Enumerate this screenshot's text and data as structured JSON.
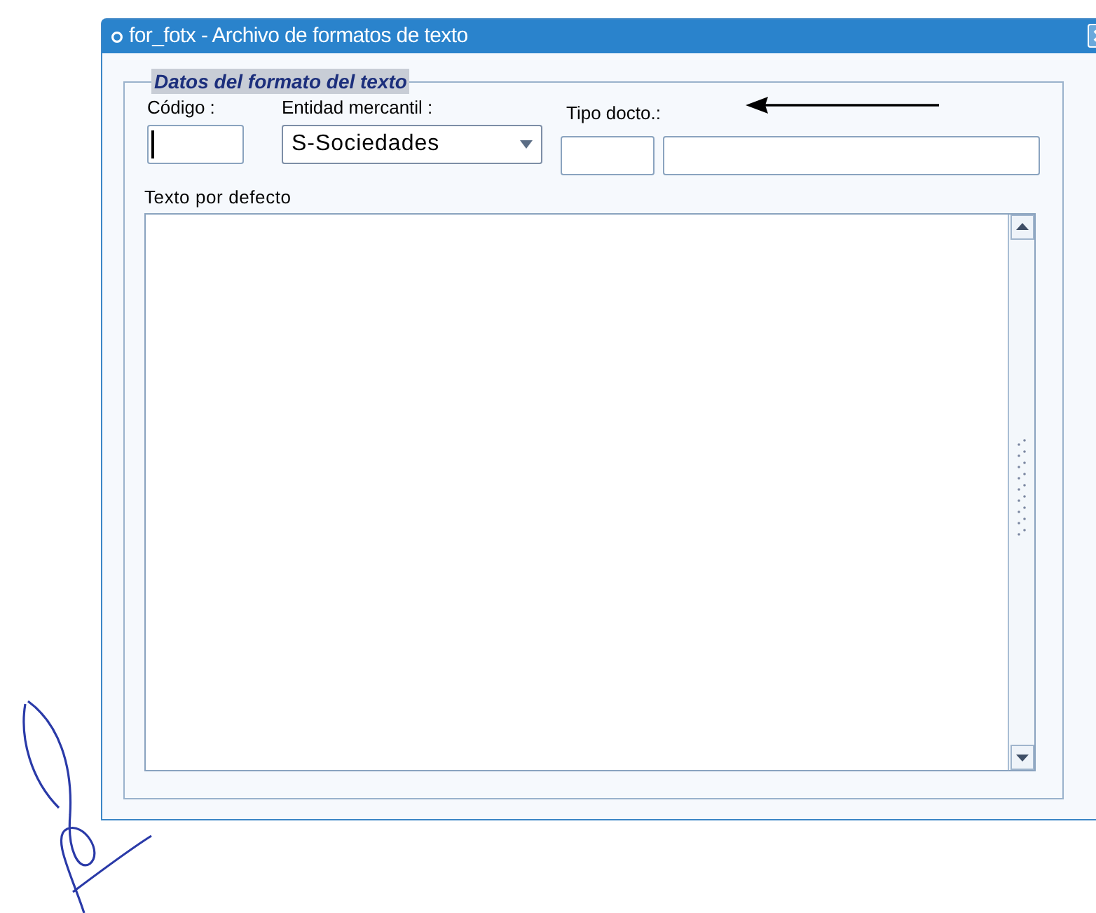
{
  "window": {
    "title": "for_fotx - Archivo de formatos de texto"
  },
  "group": {
    "title": "Datos del formato del texto"
  },
  "fields": [
    {
      "kind": "text",
      "label": "Código :"
    },
    {
      "kind": "combo",
      "label": "Entidad mercantil :",
      "value": "S-Sociedades"
    },
    {
      "kind": "pair",
      "label": "Tipo docto.:"
    }
  ],
  "memo": {
    "label": "Texto por defecto"
  }
}
